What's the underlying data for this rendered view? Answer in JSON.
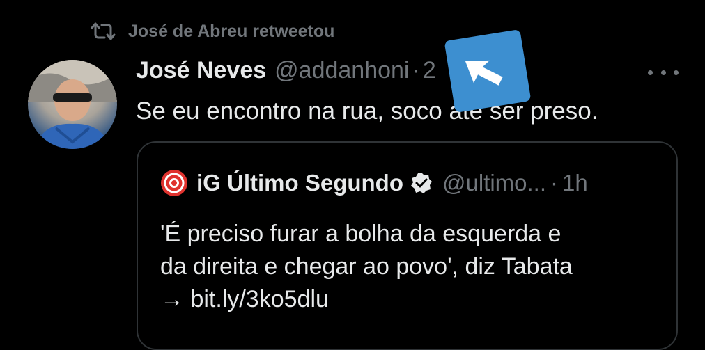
{
  "retweet": {
    "icon": "retweet-icon",
    "text": "José de Abreu retweetou"
  },
  "tweet": {
    "avatar": "avatar",
    "name": "José Neves",
    "handle": "@addanhoni",
    "separator": "·",
    "time": "2",
    "text": "Se eu encontro na rua, soco até ser preso.",
    "more_icon": "more-icon"
  },
  "quote": {
    "logo": "ig-logo-icon",
    "name": "iG Último Segundo",
    "verified_icon": "verified-badge-icon",
    "handle": "@ultimo...",
    "separator": "·",
    "time": "1h",
    "lines": [
      "'É preciso furar a bolha da esquerda e",
      "da direita e chegar ao povo', diz Tabata",
      "→ bit.ly/3ko5dlu"
    ]
  },
  "overlay": {
    "icon": "cursor-arrow-icon",
    "color": "#3d8fd0"
  },
  "colors": {
    "background": "#000000",
    "primary_text": "#e7e9ea",
    "secondary_text": "#71767b",
    "border": "#2f3336"
  }
}
